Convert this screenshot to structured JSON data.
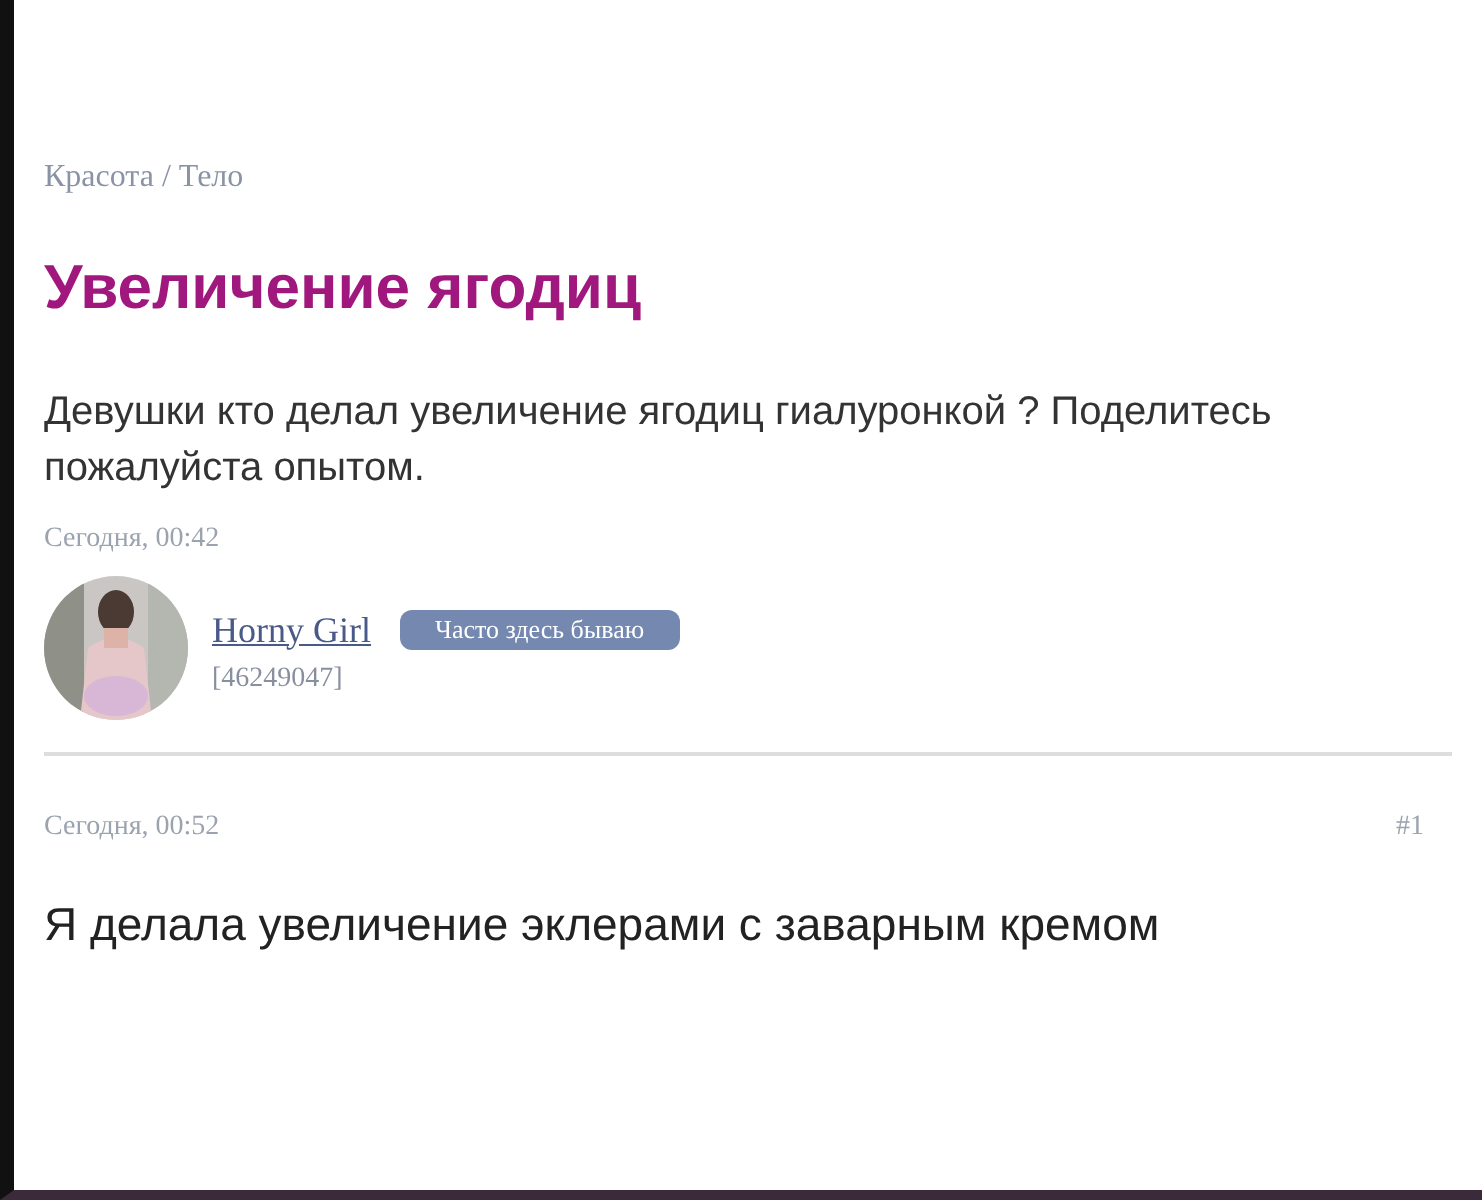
{
  "breadcrumb": "Красота / Тело",
  "topic": {
    "title": "Увеличение ягодиц",
    "text": "Девушки кто делал увеличение ягодиц гиалуронкой ? Поделитесь пожалуйста опытом.",
    "time": "Сегодня, 00:42"
  },
  "author": {
    "name": "Horny Girl",
    "badge": "Часто здесь бываю",
    "id": "[46249047]"
  },
  "replies": [
    {
      "time": "Сегодня, 00:52",
      "number": "#1",
      "text": "Я делала увеличение эклерами с заварным кремом"
    }
  ]
}
